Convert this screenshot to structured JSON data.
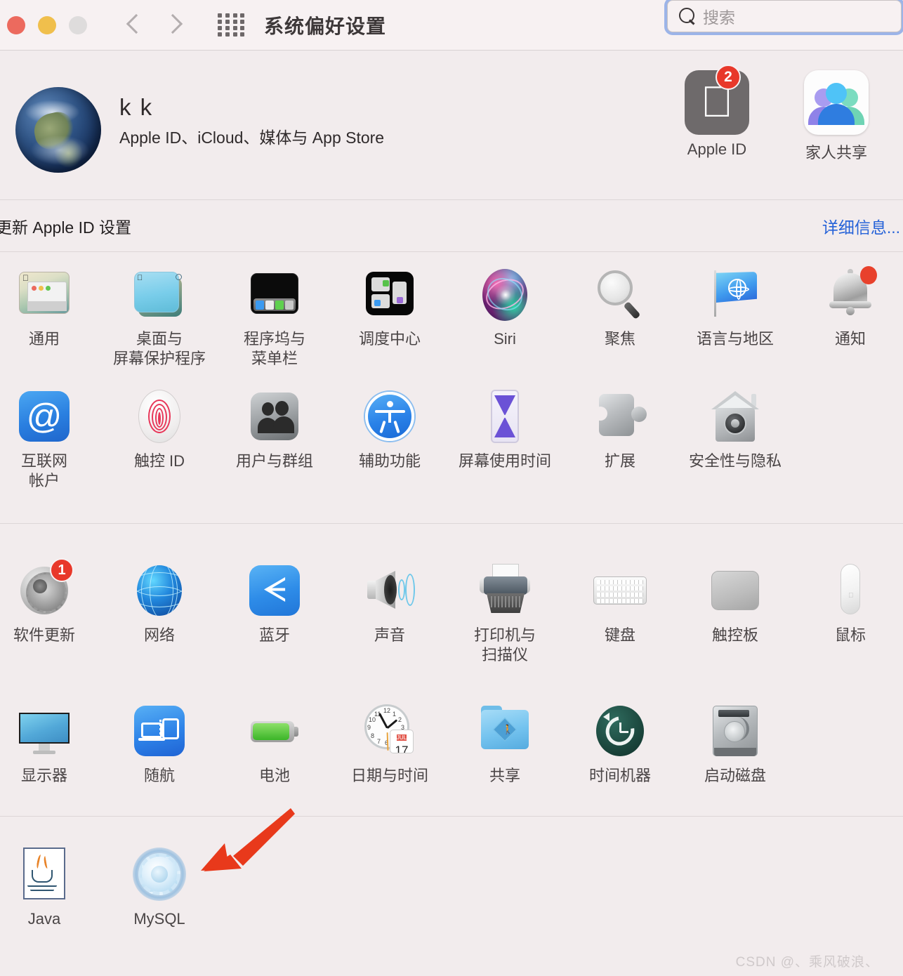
{
  "window": {
    "title": "系统偏好设置",
    "traffic_lights": [
      "close",
      "minimize",
      "zoom"
    ],
    "nav_back": "back-arrow",
    "nav_forward": "forward-arrow",
    "grid_button": "show-all-grid",
    "colors": {
      "close": "#ec6a5e",
      "minimize": "#f0bf4c",
      "zoom": "#dedcdc",
      "toolbar_bg": "#f7f1f2",
      "body_bg": "#f2eced",
      "link": "#2562d8",
      "badge": "#e8382a",
      "focus_ring": "#9cb4e8"
    }
  },
  "search": {
    "placeholder": "搜索",
    "value": "",
    "icon": "search-icon"
  },
  "account": {
    "name": "k k",
    "subtitle": "Apple ID、iCloud、媒体与 App Store",
    "avatar": "earth-avatar",
    "tiles": [
      {
        "label": "Apple ID",
        "icon": "apple-logo-icon",
        "badge": "2"
      },
      {
        "label": "家人共享",
        "icon": "family-sharing-icon",
        "badge": ""
      }
    ]
  },
  "banner": {
    "text": "更新 Apple ID 设置",
    "link": "详细信息..."
  },
  "sections": [
    {
      "id": "section-1",
      "rows": [
        [
          {
            "label": "通用",
            "icon": "general-icon",
            "badge": ""
          },
          {
            "label": "桌面与\n屏幕保护程序",
            "icon": "desktop-screensaver-icon",
            "badge": ""
          },
          {
            "label": "程序坞与\n菜单栏",
            "icon": "dock-menubar-icon",
            "badge": ""
          },
          {
            "label": "调度中心",
            "icon": "mission-control-icon",
            "badge": ""
          },
          {
            "label": "Siri",
            "icon": "siri-icon",
            "badge": ""
          },
          {
            "label": "聚焦",
            "icon": "spotlight-icon",
            "badge": ""
          },
          {
            "label": "语言与地区",
            "icon": "language-region-icon",
            "badge": ""
          },
          {
            "label": "通知",
            "icon": "notifications-icon",
            "badge": "dot"
          }
        ],
        [
          {
            "label": "互联网\n帐户",
            "icon": "internet-accounts-icon",
            "badge": ""
          },
          {
            "label": "触控 ID",
            "icon": "touch-id-icon",
            "badge": ""
          },
          {
            "label": "用户与群组",
            "icon": "users-groups-icon",
            "badge": ""
          },
          {
            "label": "辅助功能",
            "icon": "accessibility-icon",
            "badge": ""
          },
          {
            "label": "屏幕使用时间",
            "icon": "screen-time-icon",
            "badge": ""
          },
          {
            "label": "扩展",
            "icon": "extensions-icon",
            "badge": ""
          },
          {
            "label": "安全性与隐私",
            "icon": "security-privacy-icon",
            "badge": ""
          }
        ]
      ]
    },
    {
      "id": "section-2",
      "rows": [
        [
          {
            "label": "软件更新",
            "icon": "software-update-icon",
            "badge": "1"
          },
          {
            "label": "网络",
            "icon": "network-icon",
            "badge": ""
          },
          {
            "label": "蓝牙",
            "icon": "bluetooth-icon",
            "badge": ""
          },
          {
            "label": "声音",
            "icon": "sound-icon",
            "badge": ""
          },
          {
            "label": "打印机与\n扫描仪",
            "icon": "printers-scanners-icon",
            "badge": ""
          },
          {
            "label": "键盘",
            "icon": "keyboard-icon",
            "badge": ""
          },
          {
            "label": "触控板",
            "icon": "trackpad-icon",
            "badge": ""
          },
          {
            "label": "鼠标",
            "icon": "mouse-icon",
            "badge": ""
          }
        ],
        [
          {
            "label": "显示器",
            "icon": "displays-icon",
            "badge": ""
          },
          {
            "label": "随航",
            "icon": "sidecar-icon",
            "badge": ""
          },
          {
            "label": "电池",
            "icon": "battery-icon",
            "badge": ""
          },
          {
            "label": "日期与时间",
            "icon": "date-time-icon",
            "badge": ""
          },
          {
            "label": "共享",
            "icon": "sharing-icon",
            "badge": ""
          },
          {
            "label": "时间机器",
            "icon": "time-machine-icon",
            "badge": ""
          },
          {
            "label": "启动磁盘",
            "icon": "startup-disk-icon",
            "badge": ""
          }
        ]
      ]
    },
    {
      "id": "section-3",
      "rows": [
        [
          {
            "label": "Java",
            "icon": "java-icon",
            "badge": ""
          },
          {
            "label": "MySQL",
            "icon": "mysql-icon",
            "badge": ""
          }
        ]
      ]
    }
  ],
  "date_time_icon": {
    "month": "JUL",
    "day": "17"
  },
  "annotation": {
    "type": "red-arrow",
    "points_to": "MySQL",
    "color": "#e8391b"
  },
  "watermark": "CSDN @、乘风破浪、"
}
